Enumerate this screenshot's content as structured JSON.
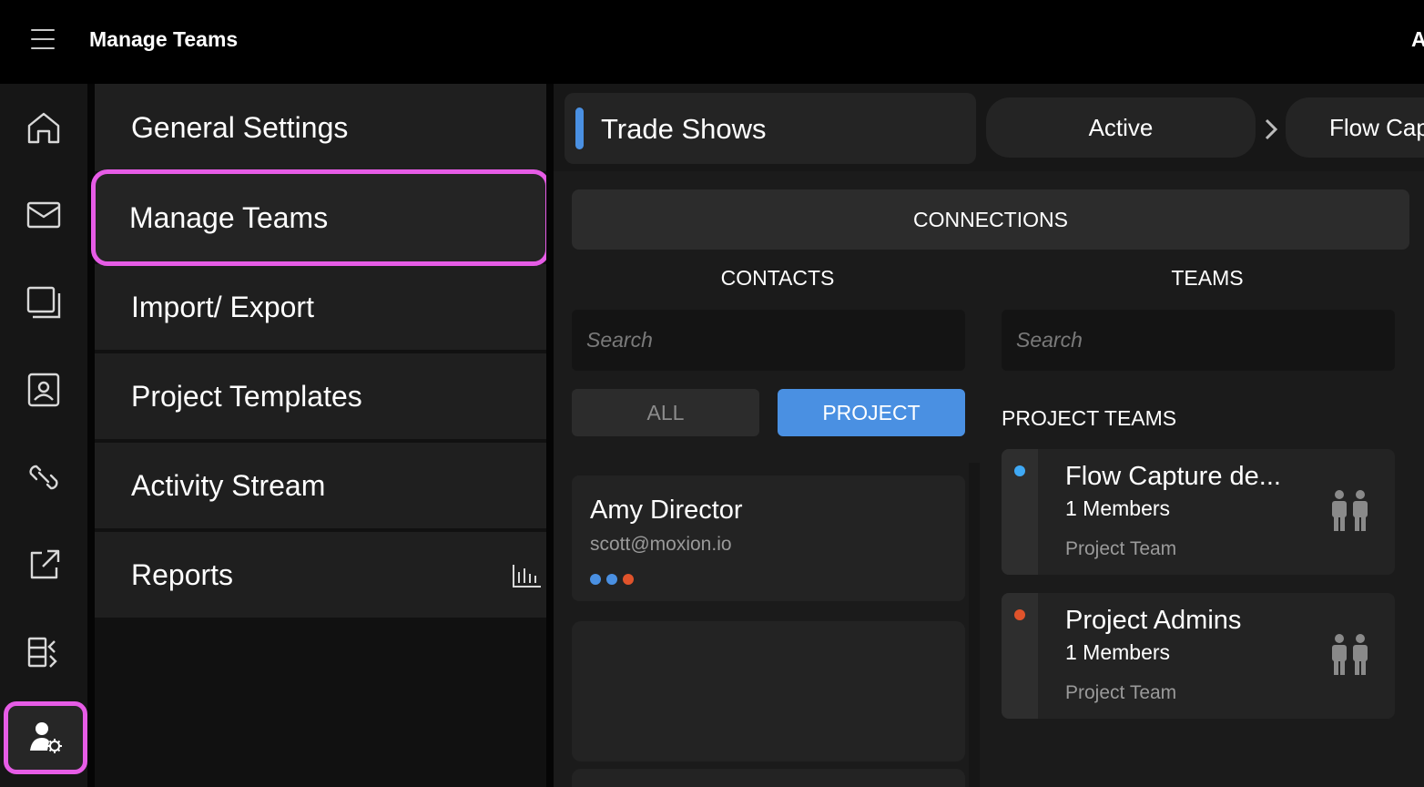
{
  "header": {
    "title": "Manage Teams",
    "right_text": "A"
  },
  "rail": {
    "items": [
      {
        "icon": "home-icon"
      },
      {
        "icon": "mail-icon"
      },
      {
        "icon": "documents-icon"
      },
      {
        "icon": "contact-card-icon"
      },
      {
        "icon": "link-icon"
      },
      {
        "icon": "share-icon"
      },
      {
        "icon": "layout-icon"
      },
      {
        "icon": "user-settings-icon",
        "active": true
      }
    ]
  },
  "menu": {
    "items": [
      {
        "label": "General Settings"
      },
      {
        "label": "Manage Teams",
        "selected": true
      },
      {
        "label": "Import/ Export"
      },
      {
        "label": "Project Templates"
      },
      {
        "label": "Activity Stream"
      },
      {
        "label": "Reports",
        "icon": "bar-chart-icon"
      }
    ]
  },
  "breadcrumb": {
    "project": "Trade Shows",
    "status": "Active",
    "next": "Flow Cap"
  },
  "connections": {
    "title": "CONNECTIONS",
    "contacts": {
      "heading": "CONTACTS",
      "search_placeholder": "Search",
      "filter_all": "ALL",
      "filter_project": "PROJECT",
      "items": [
        {
          "name": "Amy Director",
          "email": "scott@moxion.io",
          "dots": [
            "#4a90e2",
            "#4a90e2",
            "#e0532b"
          ]
        }
      ]
    },
    "teams": {
      "heading": "TEAMS",
      "search_placeholder": "Search",
      "section": "PROJECT TEAMS",
      "items": [
        {
          "name": "Flow Capture de...",
          "members": "1 Members",
          "type": "Project Team",
          "color": "#3fa9f5"
        },
        {
          "name": "Project Admins",
          "members": "1 Members",
          "type": "Project Team",
          "color": "#e0532b"
        }
      ]
    }
  },
  "colors": {
    "accent": "#4a90e2",
    "highlight": "#e65ce6"
  }
}
